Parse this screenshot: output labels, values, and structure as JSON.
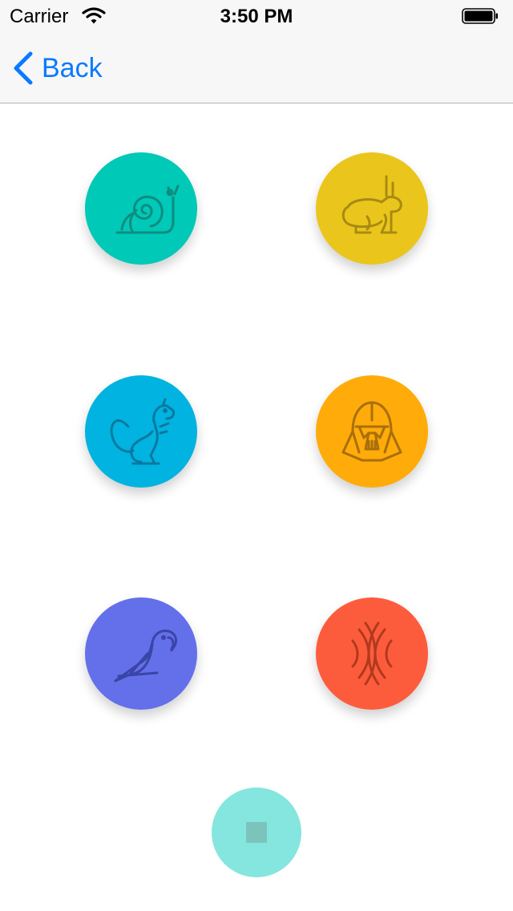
{
  "status_bar": {
    "carrier": "Carrier",
    "time": "3:50 PM"
  },
  "nav": {
    "back_label": "Back",
    "accent": "#0a7aff"
  },
  "buttons": [
    {
      "icon": "snail-icon",
      "color": "#00c9b7",
      "stroke": "#0f8c80"
    },
    {
      "icon": "rabbit-icon",
      "color": "#eac61c",
      "stroke": "#a88a12"
    },
    {
      "icon": "squirrel-icon",
      "color": "#00b3e0",
      "stroke": "#0a78a0"
    },
    {
      "icon": "darth-vader-icon",
      "color": "#ffab0a",
      "stroke": "#a86f0a"
    },
    {
      "icon": "parrot-icon",
      "color": "#6370ea",
      "stroke": "#3a45a6"
    },
    {
      "icon": "echo-icon",
      "color": "#fd5c3c",
      "stroke": "#b03a1e"
    }
  ],
  "stop_button": {
    "icon": "stop-icon",
    "color": "#84e6de",
    "square_color": "#7cc4bb"
  }
}
